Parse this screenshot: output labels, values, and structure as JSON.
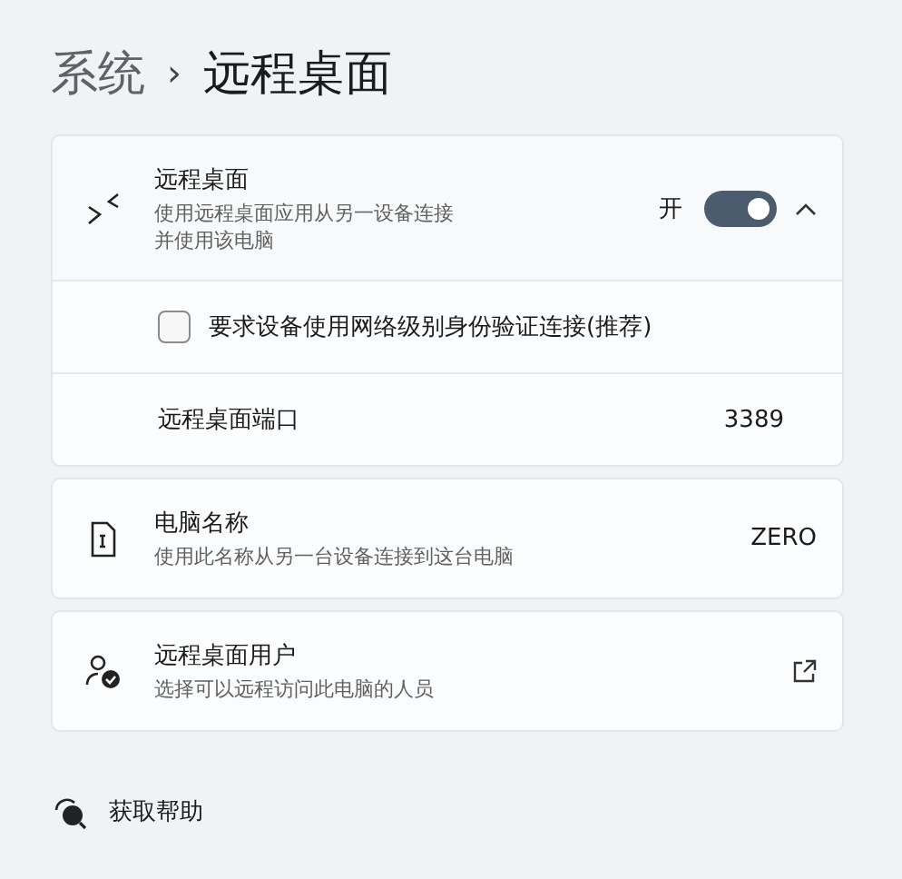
{
  "breadcrumb": [
    {
      "label": "系统",
      "current": false
    },
    {
      "label": "›",
      "kind": "separator"
    },
    {
      "label": "远程桌面",
      "current": true
    }
  ],
  "remote_desktop": {
    "title": "远程桌面",
    "description": "使用远程桌面应用从另一设备连接并使用该电脑",
    "toggle_label": "开",
    "on": true,
    "expanded": true,
    "options": [
      {
        "kind": "checkbox",
        "label": "要求设备使用网络级别身份验证连接(推荐)",
        "checked": false
      },
      {
        "kind": "value",
        "label": "远程桌面端口",
        "value": "3389"
      }
    ]
  },
  "cards": [
    {
      "kind": "value",
      "title": "电脑名称",
      "description": "使用此名称从另一台设备连接到这台电脑",
      "value": "ZERO"
    },
    {
      "kind": "link",
      "title": "远程桌面用户",
      "description": "选择可以远程访问此电脑的人员"
    }
  ],
  "help": {
    "label": "获取帮助"
  }
}
